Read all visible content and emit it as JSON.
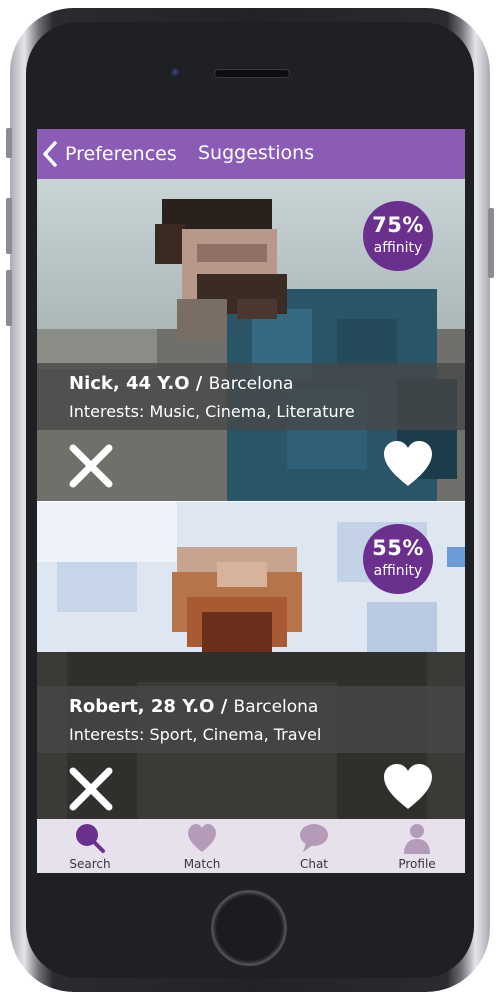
{
  "header": {
    "back_label": "Preferences",
    "title": "Suggestions"
  },
  "colors": {
    "brand_purple": "#8b5cb6",
    "affinity_badge": "#6b2f8e",
    "tabbar_bg": "#e7e1ec",
    "active_tab_icon": "#6b2f8e",
    "inactive_tab_icon": "#b39bb9"
  },
  "profiles": [
    {
      "name_age": "Nick, 44 Y.O",
      "separator": " / ",
      "city": "Barcelona",
      "interests": "Interests: Music, Cinema, Literature",
      "affinity_percent": "75%",
      "affinity_label": "affinity",
      "dismiss_icon": "close-icon",
      "like_icon": "heart-icon"
    },
    {
      "name_age": "Robert, 28 Y.O",
      "separator": " / ",
      "city": "Barcelona",
      "interests": "Interests: Sport, Cinema, Travel",
      "affinity_percent": "55%",
      "affinity_label": "affinity",
      "dismiss_icon": "close-icon",
      "like_icon": "heart-icon"
    }
  ],
  "tabs": [
    {
      "label": "Search",
      "icon": "search-icon",
      "active": true
    },
    {
      "label": "Match",
      "icon": "heart-icon",
      "active": false
    },
    {
      "label": "Chat",
      "icon": "chat-bubble-icon",
      "active": false
    },
    {
      "label": "Profile",
      "icon": "person-icon",
      "active": false
    }
  ]
}
